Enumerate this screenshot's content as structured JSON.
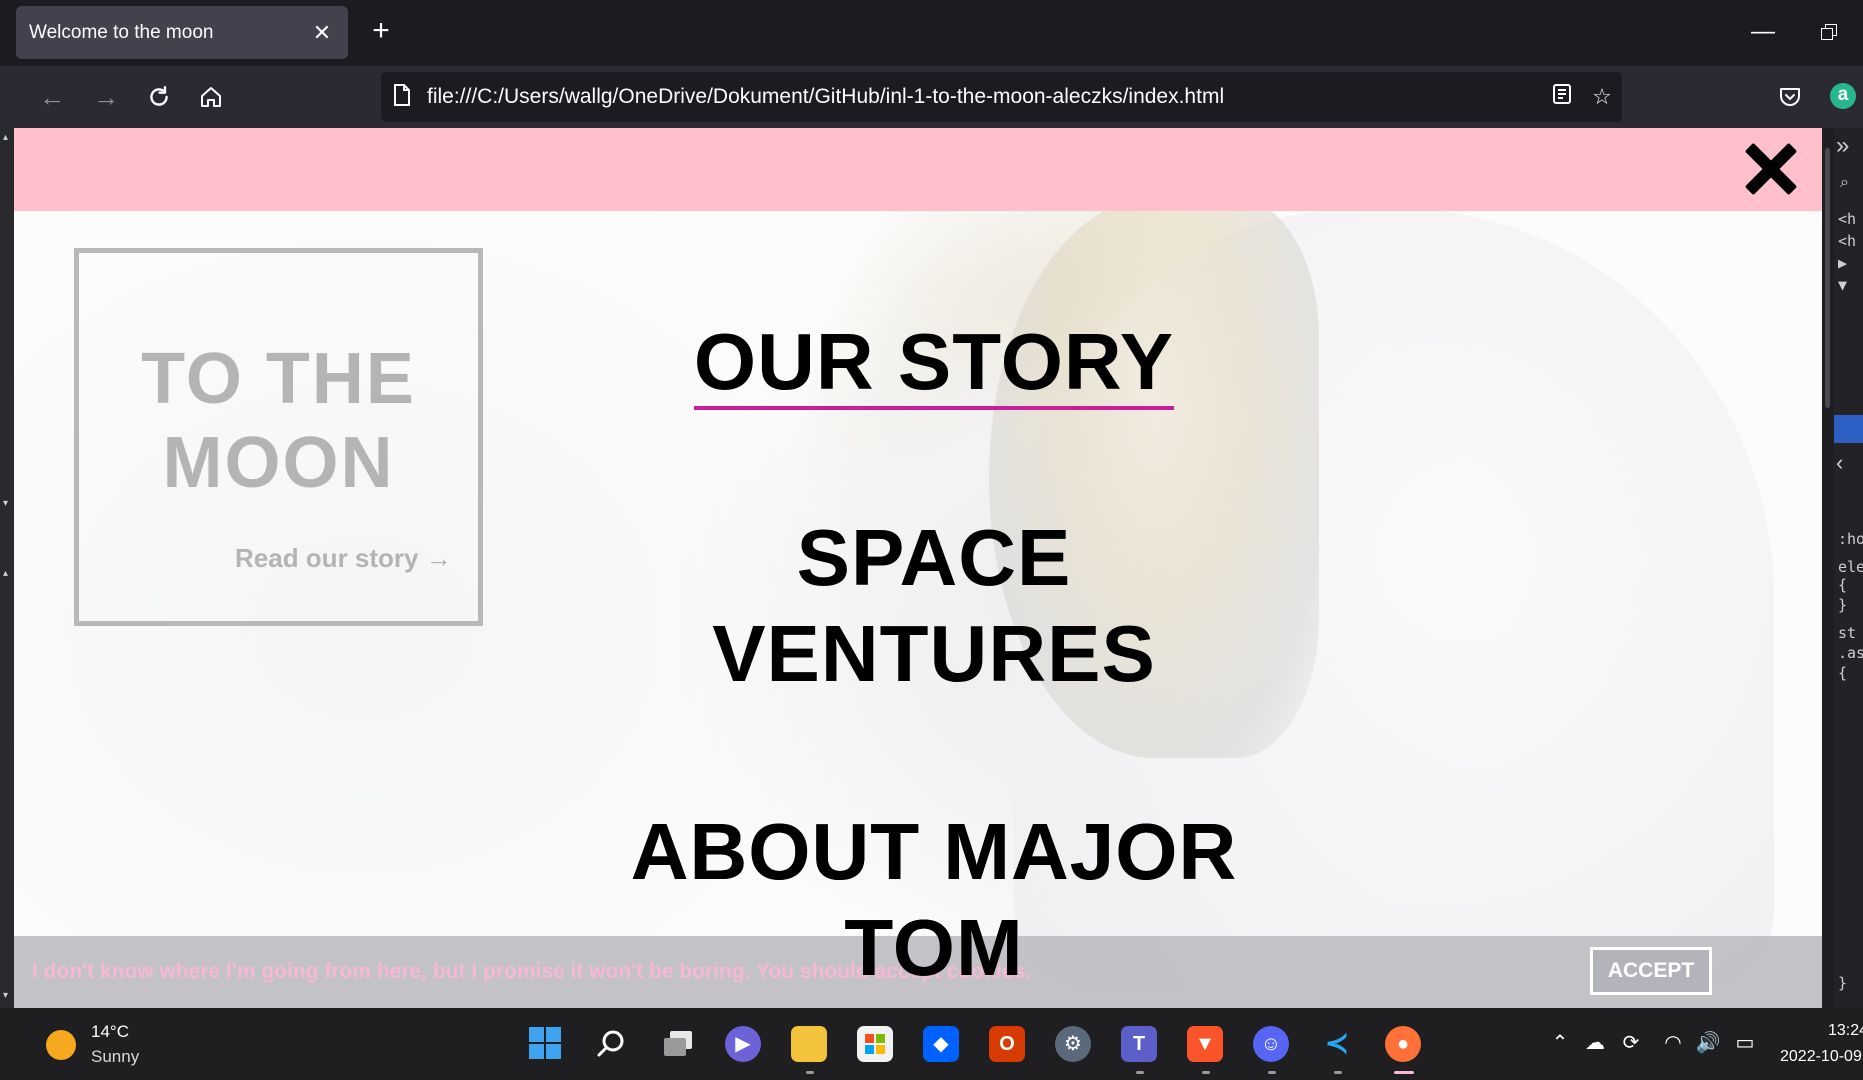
{
  "browser": {
    "tab_title": "Welcome to the moon",
    "tab_close_glyph": "✕",
    "new_tab_glyph": "+",
    "url": "file:///C:/Users/wallg/OneDrive/Dokument/GitHub/inl-1-to-the-moon-aleczks/index.html",
    "extension_letter": "a",
    "minimize_glyph": "—"
  },
  "page": {
    "close_label": "close-menu",
    "card_title": "TO THE MOON",
    "card_link": "Read our story →",
    "menu": [
      {
        "label": "OUR STORY"
      },
      {
        "label": "SPACE VENTURES"
      },
      {
        "label": "ABOUT MAJOR TOM"
      }
    ],
    "cookie_text": "I don't know where I'm going from here, but I promise it won't be boring. You should accept cookies.",
    "accept_label": "ACCEPT"
  },
  "devtools": {
    "lines": [
      "<h",
      "<h",
      "▶",
      "▼",
      ":hov",
      "elem",
      "{  ",
      "}",
      "st",
      ".ast",
      "{",
      "}"
    ]
  },
  "taskbar": {
    "temperature": "14°C",
    "condition": "Sunny",
    "time": "13:24",
    "date": "2022-10-09"
  },
  "colors": {
    "header_pink": "#ffc0cb",
    "active_underline": "#c81e9b",
    "cookie_text": "#f7b8d6"
  }
}
